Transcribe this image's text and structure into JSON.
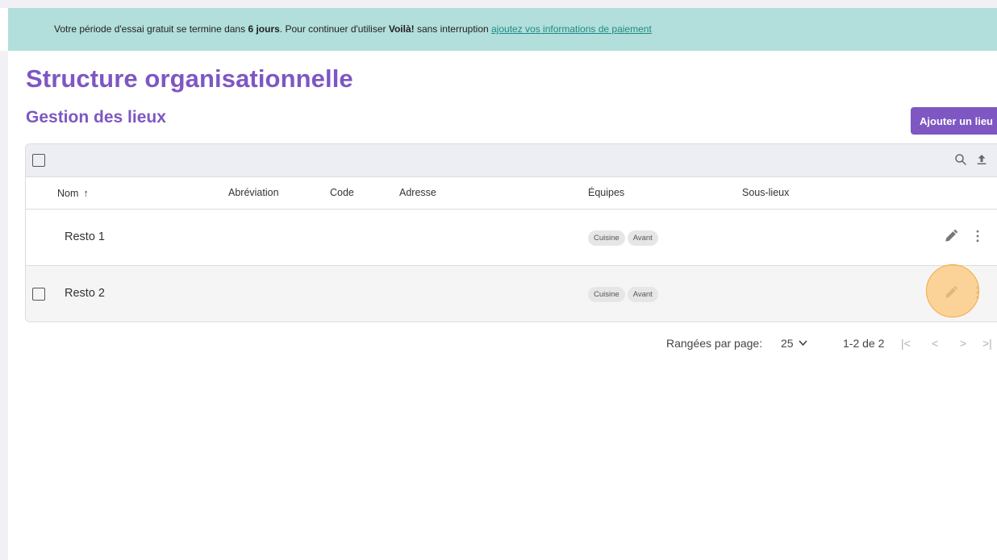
{
  "banner": {
    "text_before": "Votre période d'essai gratuit se termine dans ",
    "days": "6 jours",
    "text_middle": ". Pour continuer d'utiliser ",
    "product": "Voilà!",
    "text_after": " sans interruption ",
    "link": "ajoutez vos informations de paiement",
    "background_color": "#b2dfdb"
  },
  "page": {
    "title": "Structure organisationnelle",
    "section_title": "Gestion des lieux",
    "accent_color": "#7e57c2"
  },
  "toolbar": {
    "add_button_label": "Ajouter un lieu",
    "icons": [
      "search-icon",
      "upload-icon"
    ]
  },
  "table": {
    "columns": {
      "name": "Nom",
      "abbreviation": "Abréviation",
      "code": "Code",
      "address": "Adresse",
      "teams": "Équipes",
      "sublocations": "Sous-lieux"
    },
    "sort": {
      "column": "Nom",
      "direction": "ascending"
    },
    "rows": [
      {
        "name": "Resto 1",
        "abbreviation": "",
        "code": "",
        "address": "",
        "teams": [
          "Cuisine",
          "Avant"
        ],
        "sublocations": ""
      },
      {
        "name": "Resto 2",
        "abbreviation": "",
        "code": "",
        "address": "",
        "teams": [
          "Cuisine",
          "Avant"
        ],
        "sublocations": ""
      }
    ]
  },
  "pagination": {
    "rows_per_page_label": "Rangées par page:",
    "rows_per_page": "25",
    "range": "1-2 de 2",
    "first": "|<",
    "prev": "<",
    "next": ">",
    "last": ">|"
  }
}
